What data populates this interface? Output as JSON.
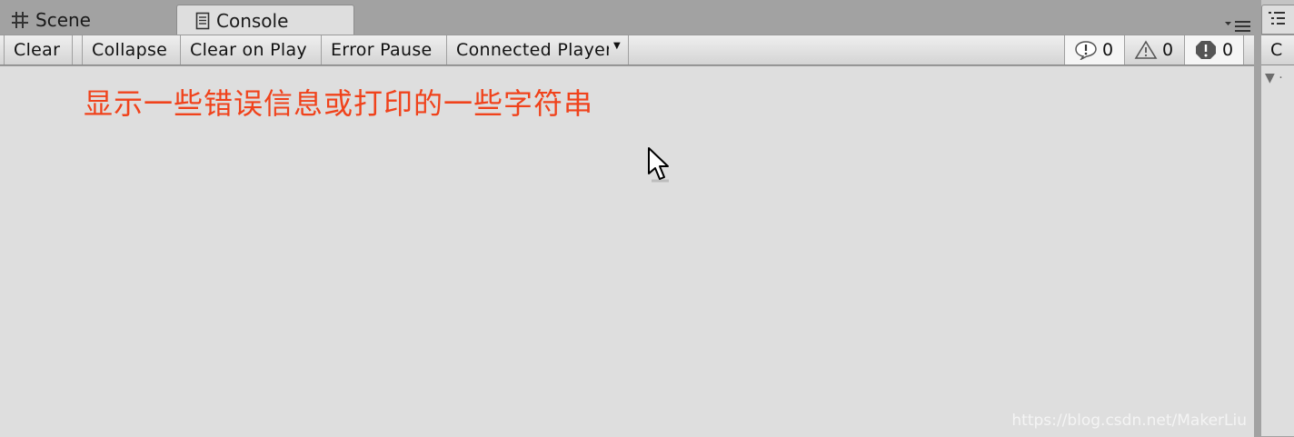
{
  "tabs": [
    {
      "label": "Scene",
      "icon": "grid-icon"
    },
    {
      "label": "Console",
      "icon": "console-icon",
      "active": true
    }
  ],
  "toolbar": {
    "clear": "Clear",
    "collapse": "Collapse",
    "clear_on_play": "Clear on Play",
    "error_pause": "Error Pause",
    "connected_player": "Connected Player",
    "counts": {
      "info": "0",
      "warning": "0",
      "error": "0"
    }
  },
  "console": {
    "annotation": "显示一些错误信息或打印的一些字符串",
    "annotation_color": "#f0421b"
  },
  "watermark": "https://blog.csdn.net/MakerLiu",
  "right_panel": {
    "toolbar_label": "C"
  },
  "colors": {
    "panel_bg": "#dedede",
    "chrome_bg": "#a2a2a2"
  }
}
